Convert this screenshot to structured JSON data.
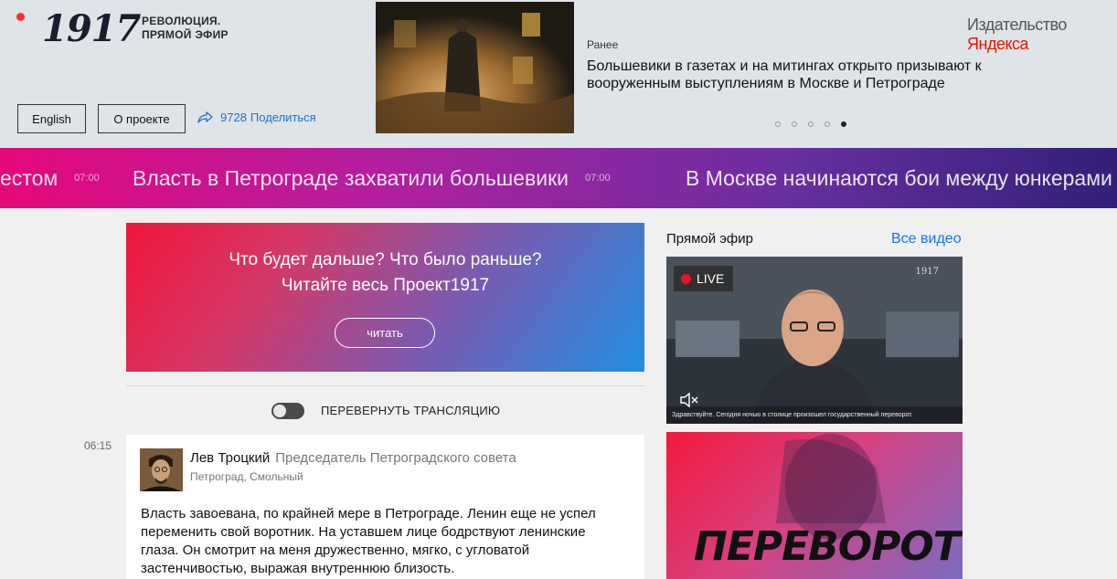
{
  "header": {
    "logo_number": "1917",
    "logo_subtitle_line1": "РЕВОЛЮЦИЯ.",
    "logo_subtitle_line2": "ПРЯМОЙ ЭФИР",
    "english_button": "English",
    "about_button": "О проекте",
    "share_count": "9728",
    "share_label": "Поделиться",
    "publisher_prefix": "Издательство ",
    "publisher_brand": "Яндекса"
  },
  "featured_news": {
    "label": "Ранее",
    "title": "Большевики в газетах и на митингах открыто призывают к вооруженным выступлениям в Москве и Петрограде",
    "slides": 5,
    "active_slide": 5
  },
  "ticker": {
    "items": [
      {
        "text": "естом",
        "time": "07:00"
      },
      {
        "text": "Власть в Петрограде захватили большевики",
        "time": "07:00"
      },
      {
        "text": "В Москве начинаются бои между юнкерами"
      }
    ]
  },
  "promo": {
    "line1": "Что будет дальше? Что было раньше?",
    "line2": "Читайте весь Проект1917",
    "button": "читать"
  },
  "feed": {
    "toggle_label": "ПЕРЕВЕРНУТЬ ТРАНСЛЯЦИЮ",
    "post": {
      "time": "06:15",
      "author": "Лев Троцкий",
      "role": "Председатель Петроградского совета",
      "place": "Петроград, Смольный",
      "text": "Власть завоевана, по крайней мере в Петрограде. Ленин еще не успел переменить свой воротник. На уставшем лице бодрствуют ленинские глаза. Он смотрит на меня дружественно, мягко, с угловатой застенчивостью, выражая внутреннюю близость."
    }
  },
  "sidebar": {
    "title": "Прямой эфир",
    "all_videos": "Все видео",
    "video": {
      "live_label": "LIVE",
      "logo": "1917",
      "caption": "Здравствуйте. Сегодня ночью в столице произошел государственный переворот."
    },
    "poster_title": "ПЕРЕВОРОТ"
  },
  "colors": {
    "live_red": "#e8132c",
    "link_blue": "#1a73e8",
    "brand_red": "#e61400"
  }
}
